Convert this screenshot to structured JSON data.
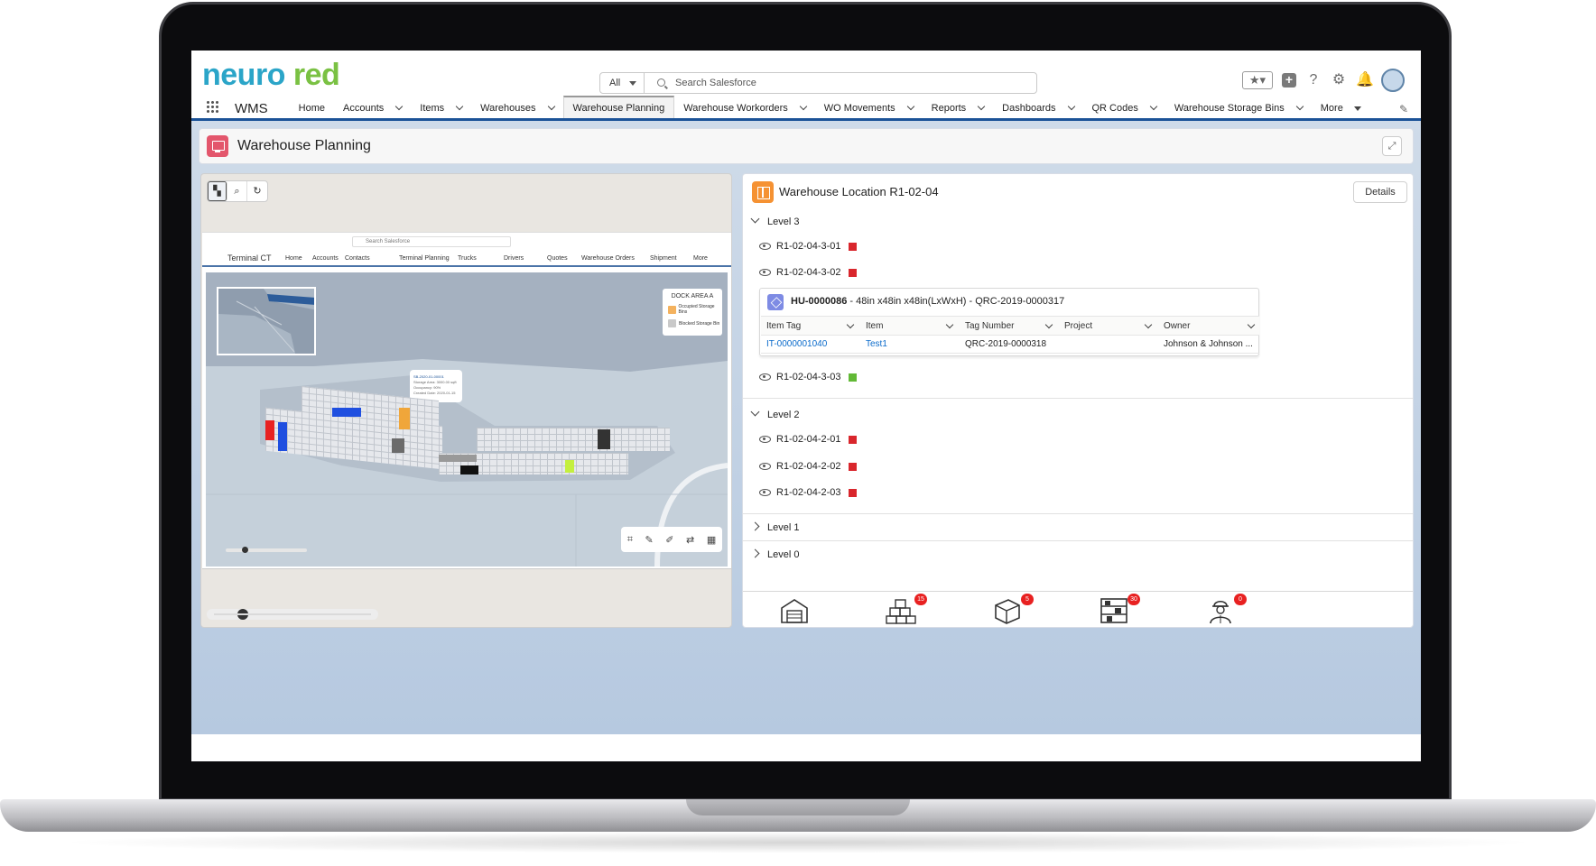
{
  "brand": {
    "logo_part1": "neuro",
    "logo_part2": "red"
  },
  "header": {
    "search_scope": "All",
    "search_placeholder": "Search Salesforce"
  },
  "nav": {
    "app_name": "WMS",
    "items": [
      {
        "label": "Home"
      },
      {
        "label": "Accounts"
      },
      {
        "label": "Items"
      },
      {
        "label": "Warehouses"
      },
      {
        "label": "Warehouse Planning"
      },
      {
        "label": "Warehouse Workorders"
      },
      {
        "label": "WO Movements"
      },
      {
        "label": "Reports"
      },
      {
        "label": "Dashboards"
      },
      {
        "label": "QR Codes"
      },
      {
        "label": "Warehouse Storage Bins"
      },
      {
        "label": "More"
      }
    ],
    "active_index": 4
  },
  "page": {
    "title": "Warehouse Planning"
  },
  "map": {
    "mini_search": "Search Salesforce",
    "mini_app": "Terminal CT",
    "mini_nav": [
      "Home",
      "Accounts",
      "Contacts",
      "Terminal Planning",
      "Trucks",
      "Drivers",
      "Quotes",
      "Warehouse Orders",
      "Shipment",
      "More"
    ],
    "dock": {
      "title": "DOCK AREA A",
      "legend": [
        {
          "label": "Occupied Storage Bins",
          "color": "#f4b25e"
        },
        {
          "label": "Blocked Storage Bin",
          "color": "#c9c9c9"
        }
      ]
    },
    "popup_lines": [
      "SB-2020-01-00001",
      "Storage Area: 3000.00 sqft",
      "Occupancy: 90%",
      "Created Date: 2020-01-15"
    ]
  },
  "location": {
    "title": "Warehouse Location R1-02-04",
    "details_label": "Details",
    "levels": [
      {
        "label": "Level 3",
        "expanded": true
      },
      {
        "label": "Level 2",
        "expanded": true
      },
      {
        "label": "Level 1",
        "expanded": false
      },
      {
        "label": "Level 0",
        "expanded": false
      }
    ],
    "bins": [
      {
        "code": "R1-02-04-3-01",
        "color": "#d9262c"
      },
      {
        "code": "R1-02-04-3-02",
        "color": "#d9262c"
      },
      {
        "code": "R1-02-04-3-03",
        "color": "#62b936"
      },
      {
        "code": "R1-02-04-2-01",
        "color": "#d9262c"
      },
      {
        "code": "R1-02-04-2-02",
        "color": "#d9262c"
      },
      {
        "code": "R1-02-04-2-03",
        "color": "#d9262c"
      }
    ],
    "handling_unit": {
      "id": "HU-0000086",
      "desc": " - 48in x48in x48in(LxWxH) - QRC-2019-0000317",
      "columns": [
        "Item Tag",
        "Item",
        "Tag Number",
        "Project",
        "Owner"
      ],
      "row": {
        "item_tag": "IT-0000001040",
        "item": "Test1",
        "tag_number": "QRC-2019-0000318",
        "project": "",
        "owner": "Johnson & Johnson ..."
      }
    },
    "footer_badges": [
      {
        "icon": "warehouse-icon",
        "count": ""
      },
      {
        "icon": "boxes-stack-icon",
        "count": "15"
      },
      {
        "icon": "package-icon",
        "count": "5"
      },
      {
        "icon": "shelving-icon",
        "count": "30"
      },
      {
        "icon": "worker-icon",
        "count": "0"
      }
    ]
  }
}
